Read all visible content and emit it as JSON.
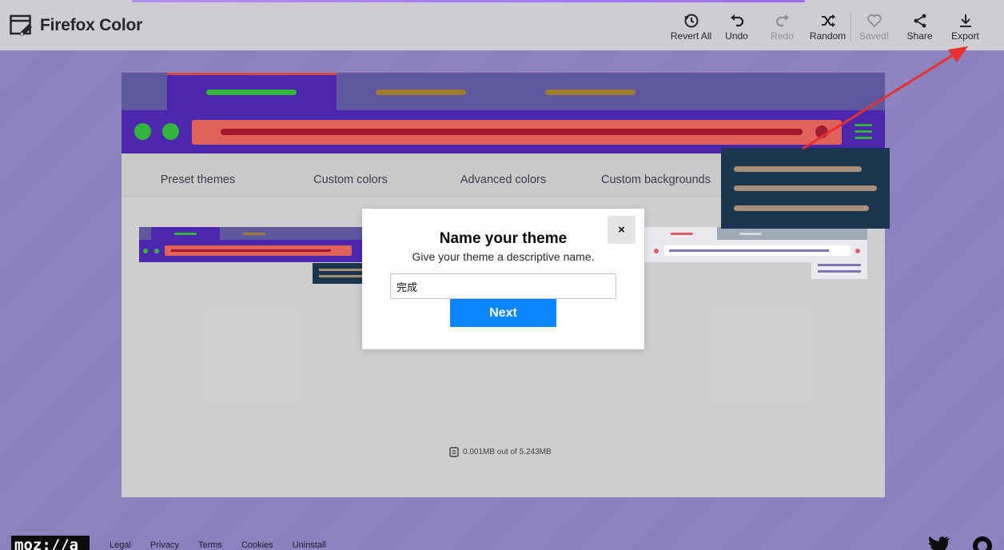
{
  "header": {
    "title": "Firefox Color",
    "actions": [
      {
        "label": "Revert All",
        "icon": "revert-icon",
        "disabled": false
      },
      {
        "label": "Undo",
        "icon": "undo-icon",
        "disabled": false
      },
      {
        "label": "Redo",
        "icon": "redo-icon",
        "disabled": true
      },
      {
        "label": "Random",
        "icon": "shuffle-icon",
        "disabled": false
      },
      {
        "label": "Saved!",
        "icon": "heart-icon",
        "disabled": true
      },
      {
        "label": "Share",
        "icon": "share-icon",
        "disabled": false
      },
      {
        "label": "Export",
        "icon": "download-icon",
        "disabled": false
      }
    ]
  },
  "nav": {
    "tabs": [
      "Preset themes",
      "Custom colors",
      "Advanced colors",
      "Custom backgrounds"
    ]
  },
  "storage": {
    "text": "0.001MB out of 5.243MB"
  },
  "modal": {
    "title": "Name your theme",
    "subtitle": "Give your theme a descriptive name.",
    "input_value": "完成",
    "next_label": "Next",
    "close_label": "×"
  },
  "footer": {
    "logo": "moz://a",
    "links": [
      "Legal",
      "Privacy",
      "Terms",
      "Cookies",
      "Uninstall"
    ]
  },
  "colors": {
    "accent_blue": "#0a84ff",
    "theme_frame": "#4923ad",
    "theme_toolbar_field": "#e15e58",
    "theme_icons": "#2fb43a",
    "popup_bg": "#17334c",
    "arrow": "#e8302d"
  }
}
